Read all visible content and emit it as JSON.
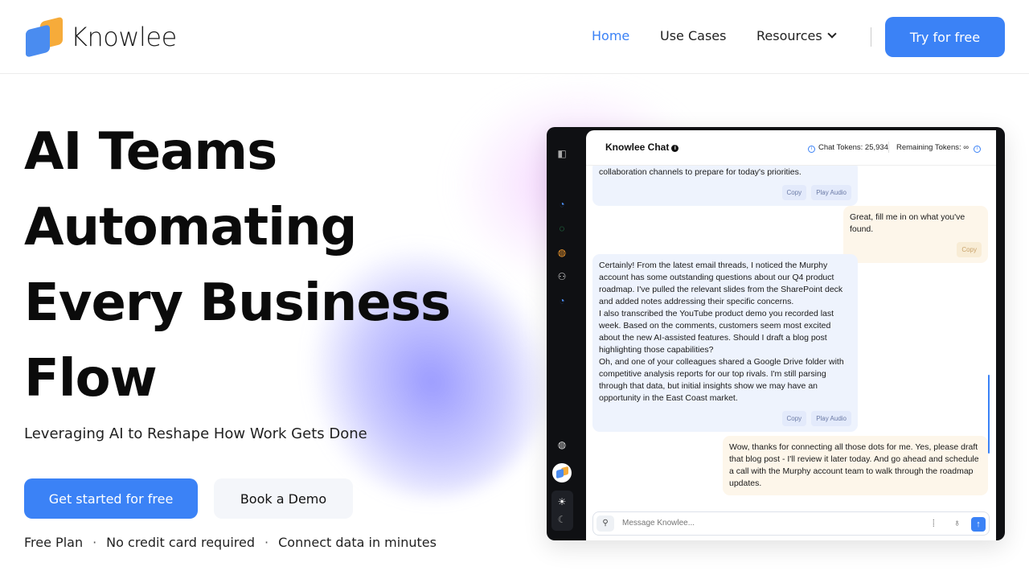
{
  "brand": {
    "name": "Knowlee"
  },
  "nav": {
    "home": "Home",
    "use_cases": "Use Cases",
    "resources": "Resources",
    "try_label": "Try for free"
  },
  "hero": {
    "title_lines": [
      "AI Teams",
      "Automating",
      "Every Business",
      "Flow"
    ],
    "subtitle": "Leveraging AI to Reshape How Work Gets Done",
    "primary_cta": "Get started for free",
    "secondary_cta": "Book a Demo",
    "perks": [
      "Free Plan",
      "No credit card required",
      "Connect data in minutes"
    ],
    "perk_separator": "·"
  },
  "app": {
    "chat_title": "Knowlee Chat",
    "chat_tokens_label": "Chat Tokens: 25,934",
    "remaining_tokens_label": "Remaining Tokens: ∞",
    "messages": [
      {
        "role": "bot",
        "text": "collaboration channels to prepare for today's priorities.",
        "actions": [
          "Copy",
          "Play Audio"
        ]
      },
      {
        "role": "user",
        "text": "Great, fill me in on what you've found.",
        "actions": [
          "Copy"
        ]
      },
      {
        "role": "bot",
        "paragraphs": [
          "Certainly! From the latest email threads, I noticed the Murphy account has some outstanding questions about our Q4 product roadmap. I've pulled the relevant slides from the SharePoint deck and added notes addressing their specific concerns.",
          "I also transcribed the YouTube product demo you recorded last week. Based on the comments, customers seem most excited about the new AI-assisted features. Should I draft a blog post highlighting those capabilities?",
          "Oh, and one of your colleagues shared a Google Drive folder with competitive analysis reports for our top rivals. I'm still parsing through that data, but initial insights show we may have an opportunity in the East Coast market."
        ],
        "actions": [
          "Copy",
          "Play Audio"
        ]
      },
      {
        "role": "user",
        "text": "Wow, thanks for connecting all those dots for me. Yes, please draft that blog post - I'll review it later today. And go ahead and schedule a call with the Murphy account team to walk through the roadmap updates.",
        "actions": []
      }
    ],
    "composer_placeholder": "Message Knowlee...",
    "colors": {
      "accent": "#3b82f6",
      "bot_bubble": "#eef3fd",
      "user_bubble": "#fdf6ea",
      "sidebar": "#0f1013"
    },
    "sidebar_icons": [
      "panel-toggle-icon",
      "pie-chart-icon",
      "chat-bubble-icon",
      "basketball-icon",
      "users-icon",
      "history-icon",
      "globe-icon",
      "avatar",
      "sun-icon",
      "moon-icon"
    ]
  }
}
